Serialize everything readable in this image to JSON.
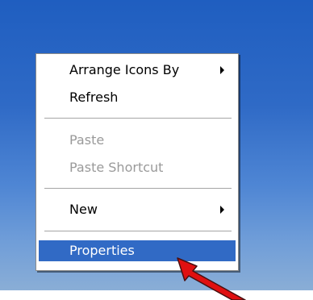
{
  "menu": {
    "items": [
      {
        "label": "Arrange Icons By",
        "enabled": true,
        "submenu": true
      },
      {
        "label": "Refresh",
        "enabled": true,
        "submenu": false
      },
      {
        "label": "Paste",
        "enabled": false,
        "submenu": false
      },
      {
        "label": "Paste Shortcut",
        "enabled": false,
        "submenu": false
      },
      {
        "label": "New",
        "enabled": true,
        "submenu": true
      },
      {
        "label": "Properties",
        "enabled": true,
        "submenu": false,
        "selected": true
      }
    ]
  },
  "colors": {
    "desktop_top": "#1f5ec0",
    "desktop_bottom": "#8fb1d6",
    "selection": "#316ac5",
    "disabled_text": "#9a9a9a",
    "pointer_arrow": "#e01010"
  },
  "annotation": {
    "icon": "red-pointer-arrow"
  }
}
